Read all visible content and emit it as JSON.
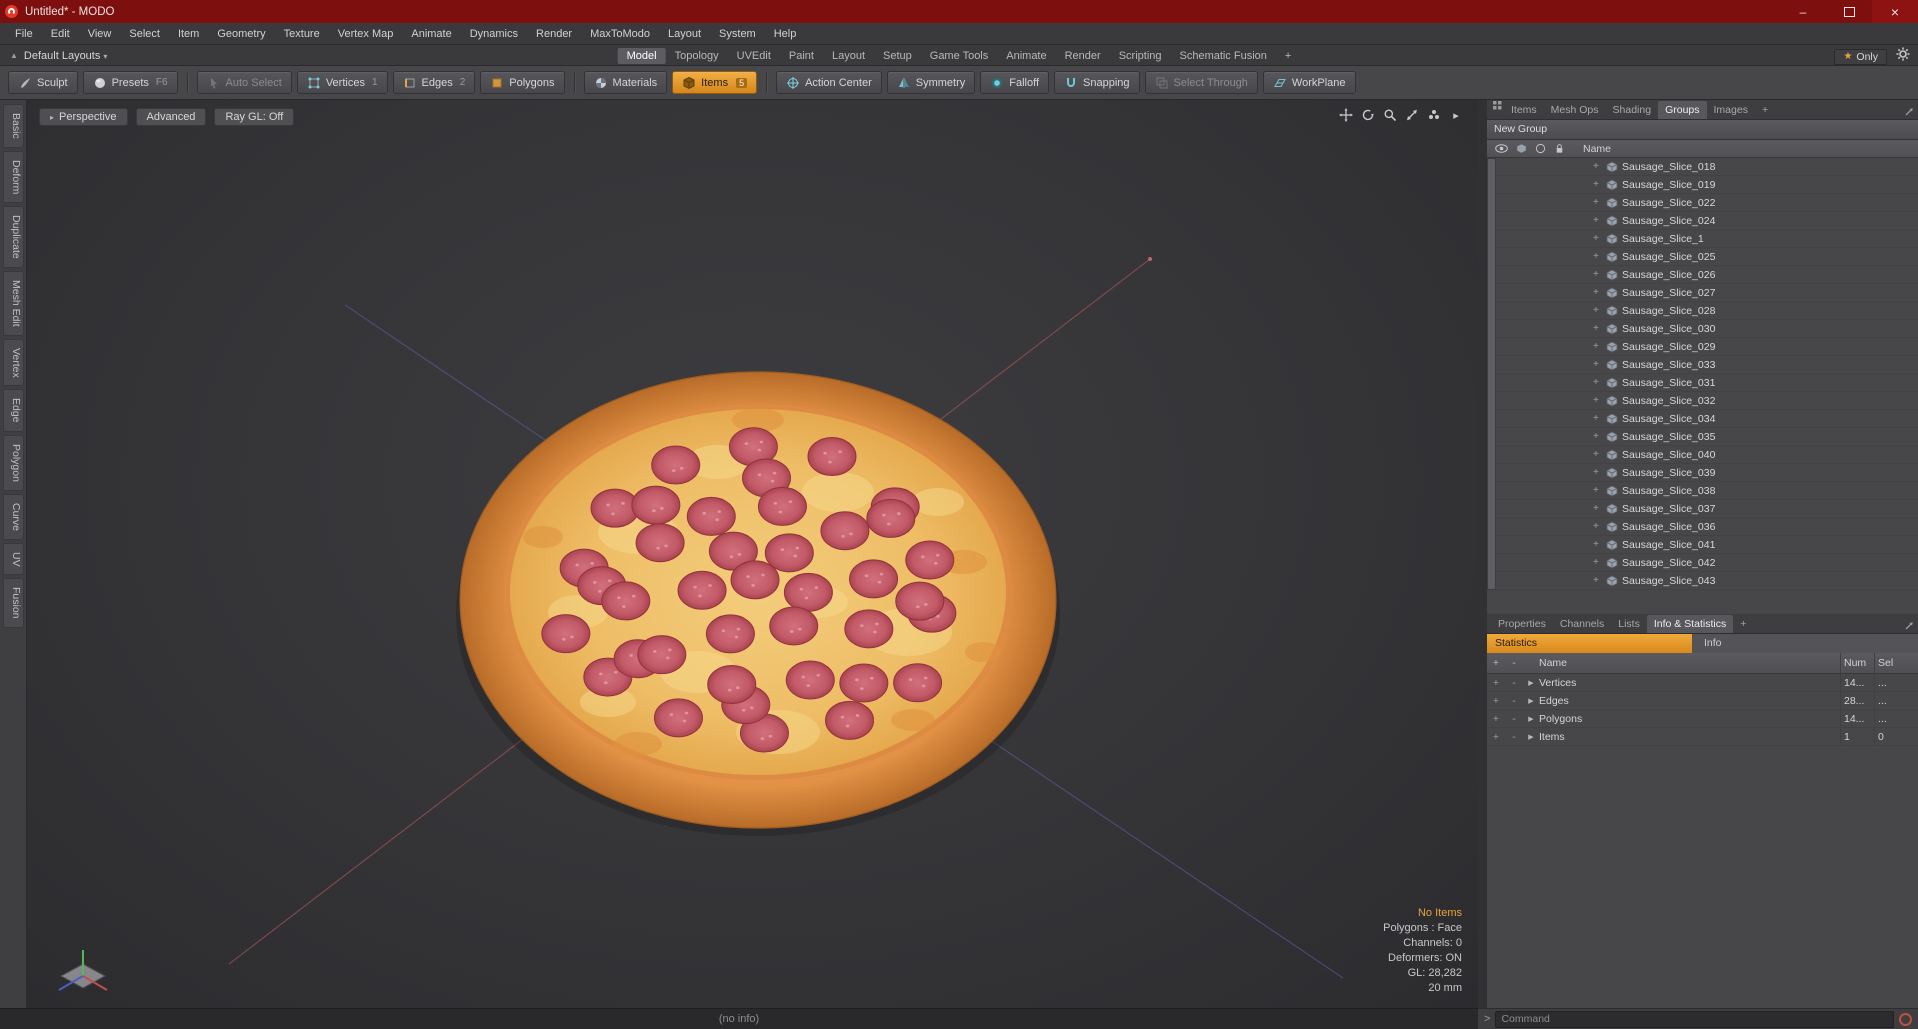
{
  "window": {
    "title": "Untitled* - MODO",
    "minimize_glyph": "–",
    "close_glyph": "×"
  },
  "menu_bar": {
    "items": [
      "File",
      "Edit",
      "View",
      "Select",
      "Item",
      "Geometry",
      "Texture",
      "Vertex Map",
      "Animate",
      "Dynamics",
      "Render",
      "MaxToModo",
      "Layout",
      "System",
      "Help"
    ]
  },
  "layout_bar": {
    "layout_preset": "Default Layouts",
    "caret": "▾",
    "tabs": [
      "Model",
      "Topology",
      "UVEdit",
      "Paint",
      "Layout",
      "Setup",
      "Game Tools",
      "Animate",
      "Render",
      "Scripting",
      "Schematic Fusion",
      "+"
    ],
    "star": "★",
    "only_button": "Only"
  },
  "toolbar": {
    "sculpt": "Sculpt",
    "presets": "Presets",
    "presets_key": "F6",
    "auto_select": "Auto Select",
    "vertices": "Vertices",
    "vertices_key": "1",
    "edges": "Edges",
    "edges_key": "2",
    "polygons": "Polygons",
    "materials": "Materials",
    "items": "Items",
    "items_badge": "5",
    "action_center": "Action Center",
    "symmetry": "Symmetry",
    "falloff": "Falloff",
    "snapping": "Snapping",
    "select_through": "Select Through",
    "workplane": "WorkPlane"
  },
  "left_tabs": {
    "items": [
      "Basic",
      "Deform",
      "Duplicate",
      "Mesh Edit",
      "Vertex",
      "Edge",
      "Polygon",
      "Curve",
      "UV",
      "Fusion"
    ]
  },
  "viewport": {
    "buttons": [
      "Perspective",
      "Advanced",
      "Ray GL: Off"
    ],
    "info": {
      "highlight": "No Items",
      "lines": [
        "Polygons : Face",
        "Channels: 0",
        "Deformers: ON",
        "GL: 28,282",
        "20 mm"
      ]
    }
  },
  "right_panel": {
    "top_tabs": [
      "Items",
      "Mesh Ops",
      "Shading",
      "Groups",
      "Images",
      "+"
    ],
    "new_group_button": "New Group",
    "list_header_name": "Name",
    "expand_glyph": "+",
    "items": [
      "Sausage_Slice_018",
      "Sausage_Slice_019",
      "Sausage_Slice_022",
      "Sausage_Slice_024",
      "Sausage_Slice_1",
      "Sausage_Slice_025",
      "Sausage_Slice_026",
      "Sausage_Slice_027",
      "Sausage_Slice_028",
      "Sausage_Slice_030",
      "Sausage_Slice_029",
      "Sausage_Slice_033",
      "Sausage_Slice_031",
      "Sausage_Slice_032",
      "Sausage_Slice_034",
      "Sausage_Slice_035",
      "Sausage_Slice_040",
      "Sausage_Slice_039",
      "Sausage_Slice_038",
      "Sausage_Slice_037",
      "Sausage_Slice_036",
      "Sausage_Slice_041",
      "Sausage_Slice_042",
      "Sausage_Slice_043"
    ]
  },
  "stats_panel": {
    "tabs": [
      "Properties",
      "Channels",
      "Lists",
      "Info & Statistics",
      "+"
    ],
    "sub_tabs": [
      "Statistics",
      "Info"
    ],
    "header": {
      "plus": "+",
      "minus": "-",
      "name": "Name",
      "num": "Num",
      "sel": "Sel"
    },
    "row_glyphs": {
      "plus": "+",
      "minus": "-",
      "arrow": "▶"
    },
    "rows": [
      {
        "name": "Vertices",
        "num": "14...",
        "sel": "..."
      },
      {
        "name": "Edges",
        "num": "28...",
        "sel": "..."
      },
      {
        "name": "Polygons",
        "num": "14...",
        "sel": "..."
      },
      {
        "name": "Items",
        "num": "1",
        "sel": "0"
      }
    ]
  },
  "status_bar": {
    "text": "(no info)"
  },
  "command_bar": {
    "prompt": ">",
    "placeholder": "Command"
  }
}
